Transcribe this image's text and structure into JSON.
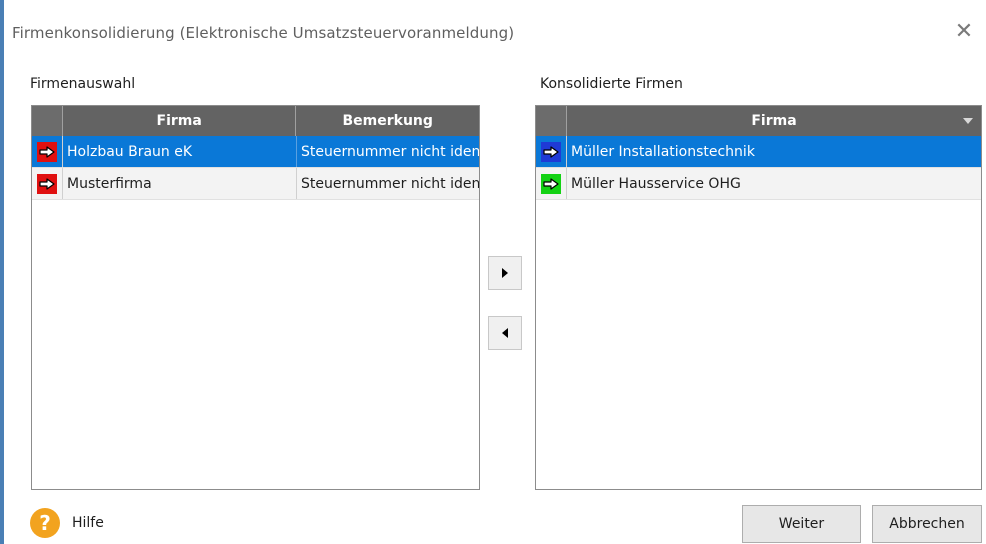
{
  "window": {
    "title": "Firmenkonsolidierung (Elektronische Umsatzsteuervoranmeldung)",
    "close_glyph": "✕"
  },
  "left": {
    "label": "Firmenauswahl",
    "columns": [
      "Firma",
      "Bemerkung"
    ],
    "rows": [
      {
        "firma": "Holzbau Braun eK",
        "bemerkung": "Steuernummer nicht identis",
        "indicator_color": "#e01010",
        "selected": true
      },
      {
        "firma": "Musterfirma",
        "bemerkung": "Steuernummer nicht identis",
        "indicator_color": "#e01010",
        "selected": false
      }
    ]
  },
  "right": {
    "label": "Konsolidierte Firmen",
    "columns": [
      "Firma"
    ],
    "rows": [
      {
        "firma": "Müller Installationstechnik",
        "indicator_color": "#1f3ad6",
        "selected": true
      },
      {
        "firma": "Müller Hausservice OHG",
        "indicator_color": "#14d214",
        "selected": false
      }
    ]
  },
  "actions": {
    "add_icon": "arrow-right-icon",
    "remove_icon": "arrow-left-icon"
  },
  "footer": {
    "help_label": "Hilfe",
    "help_glyph": "?",
    "next_label": "Weiter",
    "cancel_label": "Abbrechen"
  },
  "colors": {
    "header_bg": "#636363",
    "selection": "#0a78d7",
    "help_icon": "#f2a31f"
  }
}
